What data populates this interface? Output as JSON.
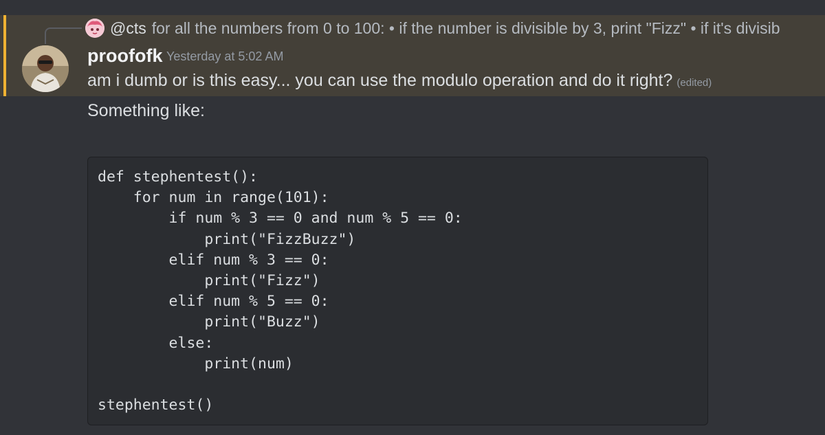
{
  "reply": {
    "username": "@cts",
    "preview": "for all the numbers from 0 to 100: • if the number is divisible by 3, print \"Fizz\"  • if it's divisib"
  },
  "message": {
    "username": "proofofk",
    "timestamp": "Yesterday at 5:02 AM",
    "line1": "am i dumb or is this easy... you can use the modulo operation and do it right?",
    "edited_label": "(edited)",
    "line2": "Something like:",
    "code": "def stephentest():\n    for num in range(101):\n        if num % 3 == 0 and num % 5 == 0:\n            print(\"FizzBuzz\")\n        elif num % 3 == 0:\n            print(\"Fizz\")\n        elif num % 5 == 0:\n            print(\"Buzz\")\n        else:\n            print(num)\n\nstephentest()"
  },
  "colors": {
    "mention_highlight": "#444038",
    "mention_bar": "#f0b232",
    "background": "#313338",
    "code_background": "#2b2d31"
  }
}
